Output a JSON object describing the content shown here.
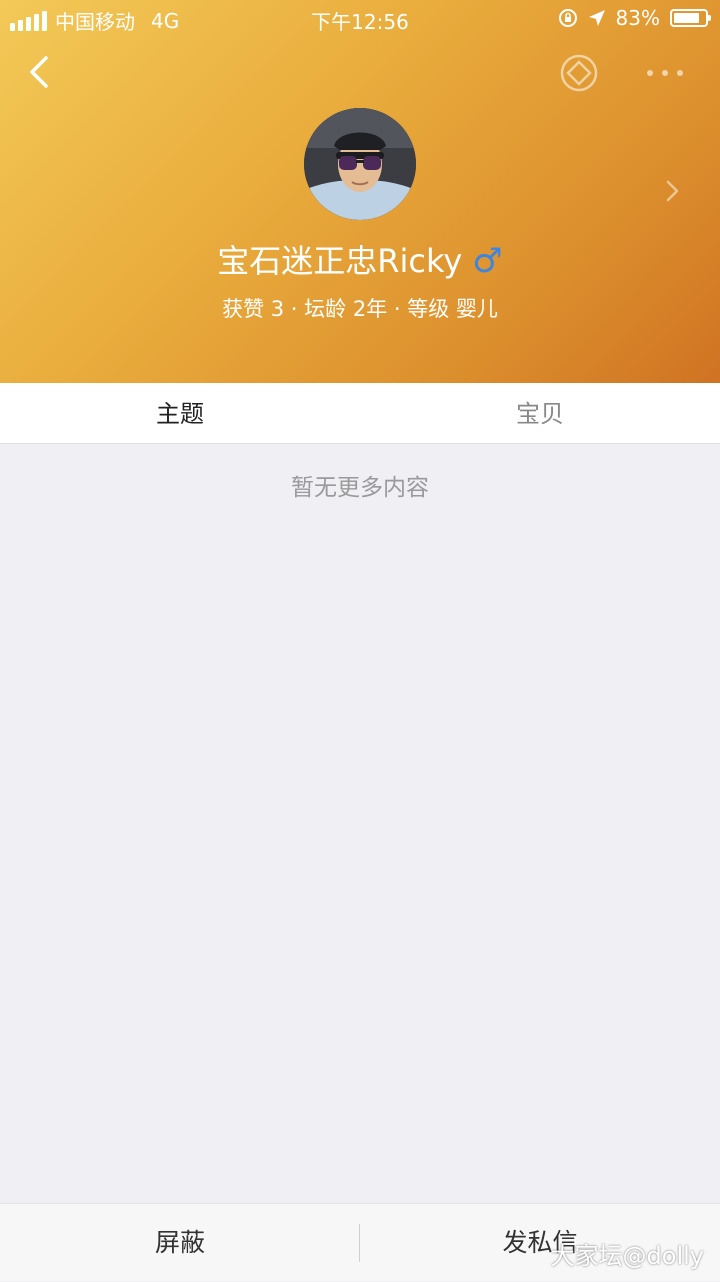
{
  "status_bar": {
    "carrier": "中国移动",
    "network": "4G",
    "time": "下午12:56",
    "battery_percent": "83%",
    "battery_level": 0.83
  },
  "nav": {
    "back_icon": "chevron-left-icon",
    "coin_icon": "coin-icon",
    "more_icon": "more-dots-icon"
  },
  "profile": {
    "name": "宝石迷正忠Ricky",
    "gender_symbol": "♂",
    "stats": "获赞 3 · 坛龄 2年 · 等级 婴儿"
  },
  "tabs": [
    {
      "label": "主题",
      "active": true
    },
    {
      "label": "宝贝",
      "active": false
    }
  ],
  "content": {
    "empty_text": "暂无更多内容"
  },
  "bottom_bar": {
    "block_label": "屏蔽",
    "message_label": "发私信"
  },
  "watermark": "大家坛@dolly",
  "colors": {
    "header_start": "#f3c957",
    "header_end": "#cf7323",
    "gender_blue": "#3d86e0",
    "background": "#efeff4"
  }
}
